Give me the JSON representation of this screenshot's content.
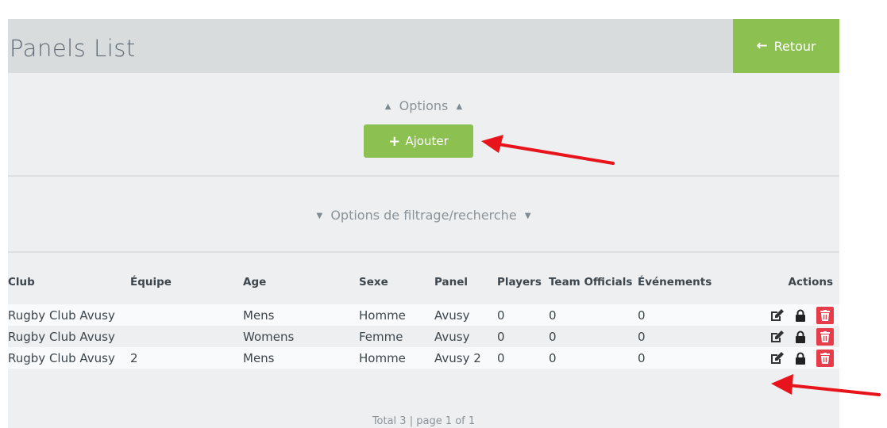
{
  "header": {
    "title": "Panels List",
    "back_label": "Retour"
  },
  "options": {
    "label": "Options",
    "add_label": "Ajouter"
  },
  "filter": {
    "label": "Options de filtrage/recherche"
  },
  "table": {
    "columns": [
      "Club",
      "Équipe",
      "Age",
      "Sexe",
      "Panel",
      "Players",
      "Team Officials",
      "Événements",
      "Actions"
    ],
    "rows": [
      [
        "Rugby Club Avusy",
        "",
        "Mens",
        "Homme",
        "Avusy",
        "0",
        "0",
        "0"
      ],
      [
        "Rugby Club Avusy",
        "",
        "Womens",
        "Femme",
        "Avusy",
        "0",
        "0",
        "0"
      ],
      [
        "Rugby Club Avusy",
        "2",
        "Mens",
        "Homme",
        "Avusy 2",
        "0",
        "0",
        "0"
      ]
    ]
  },
  "footer": {
    "text": "Total 3  |  page 1 of 1"
  },
  "icons": {
    "edit": "edit-icon",
    "lock": "lock-icon",
    "delete": "trash-icon",
    "back": "arrow-left-icon",
    "add": "plus-icon"
  },
  "colors": {
    "accent_green": "#8cc152",
    "danger_red": "#e73d4a",
    "annotation_red": "#e8141c"
  }
}
